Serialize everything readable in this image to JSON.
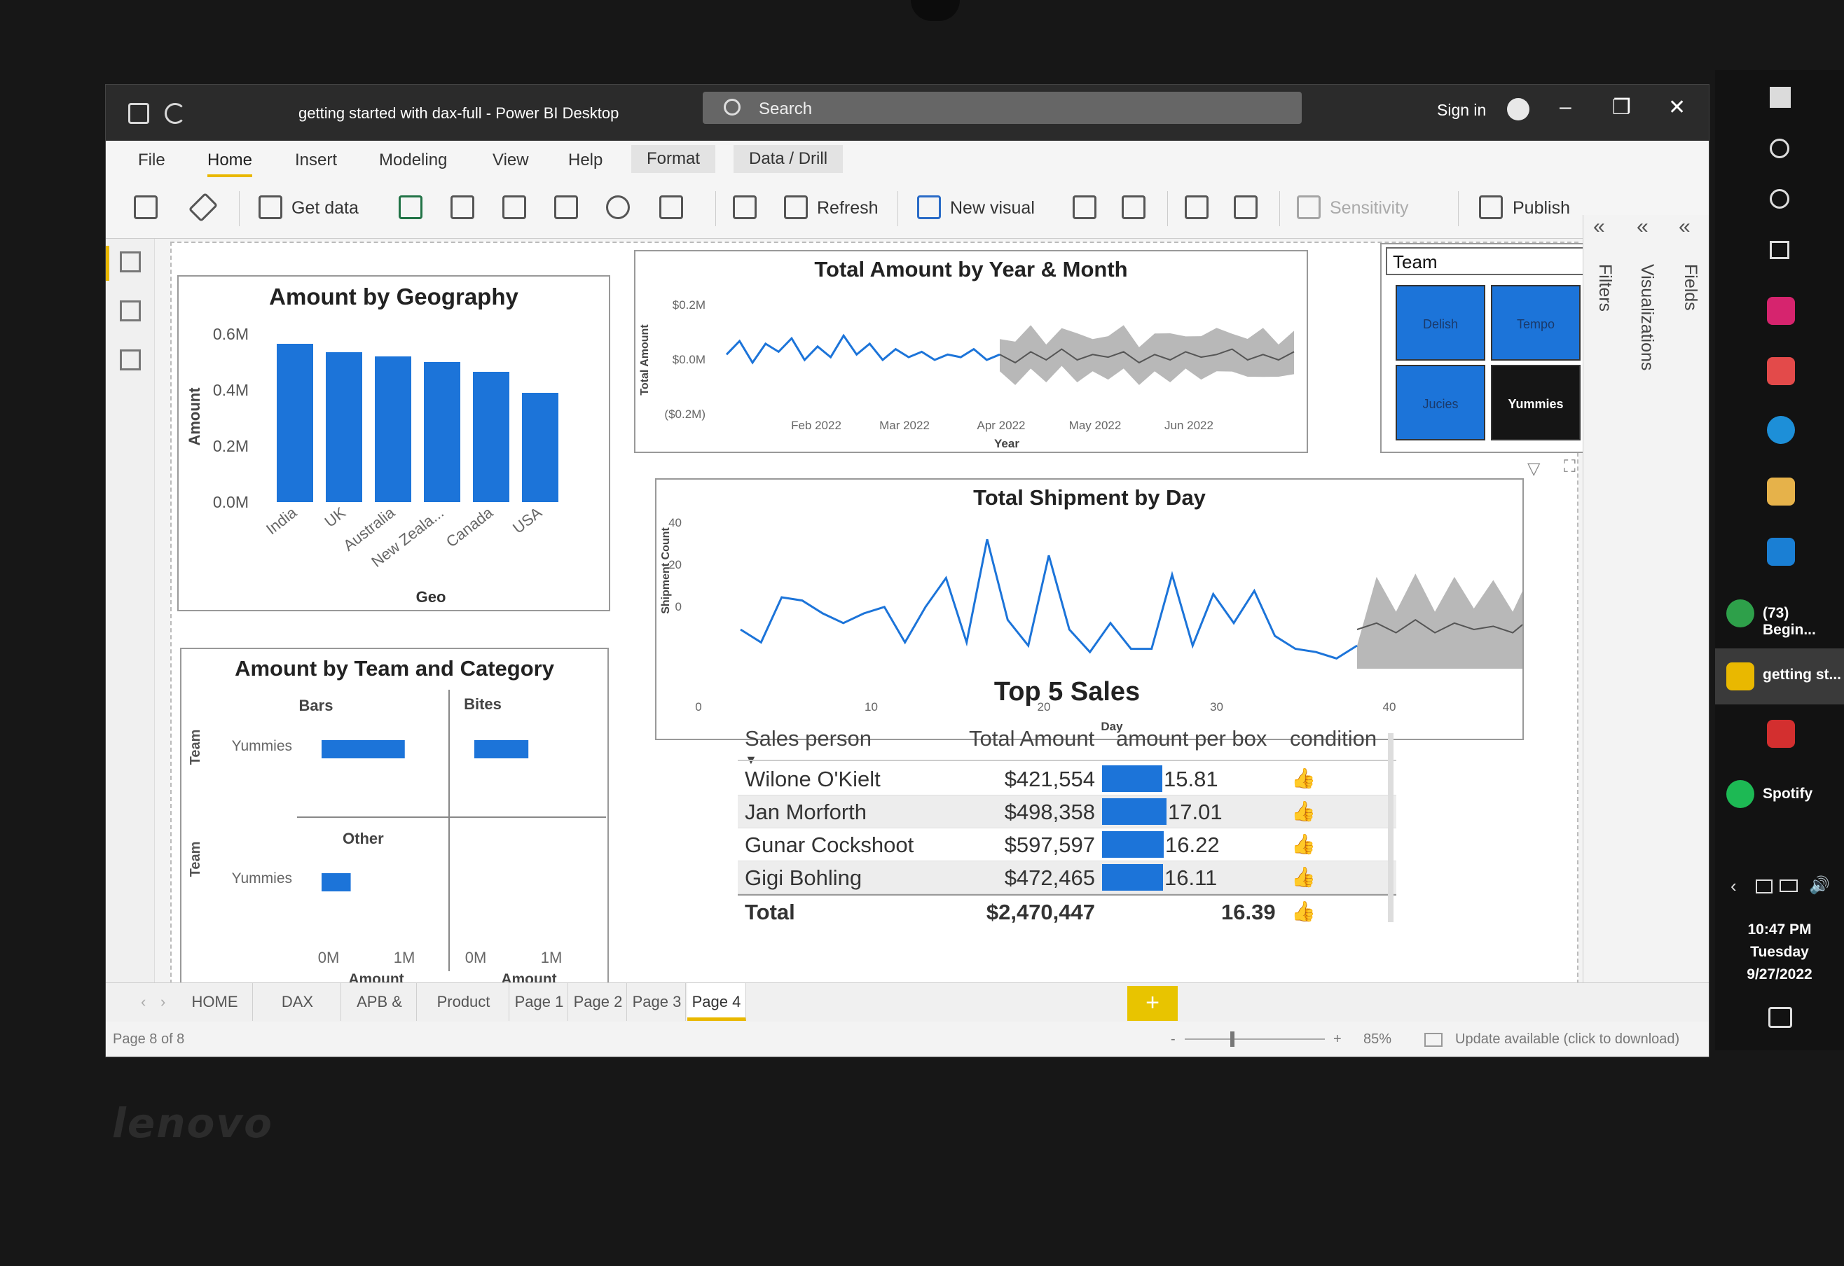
{
  "window": {
    "title": "getting started with dax-full - Power BI Desktop",
    "search_placeholder": "Search",
    "sign_in": "Sign in"
  },
  "menu": [
    "File",
    "Home",
    "Insert",
    "Modeling",
    "View",
    "Help",
    "Format",
    "Data / Drill"
  ],
  "ribbon": {
    "get_data": "Get data",
    "refresh": "Refresh",
    "new_visual": "New visual",
    "sensitivity": "Sensitivity",
    "publish": "Publish"
  },
  "panes": {
    "filters": "Filters",
    "visualizations": "Visualizations",
    "fields": "Fields"
  },
  "visuals": {
    "geo": {
      "title": "Amount by Geography",
      "xlabel": "Geo",
      "ylabel": "Amount",
      "yticks": [
        "0.6M",
        "0.4M",
        "0.2M",
        "0.0M"
      ]
    },
    "team_cat": {
      "title": "Amount by Team and Category",
      "col1": "Bars",
      "col2": "Bites",
      "row2_group": "Other",
      "team_label": "Team",
      "member": "Yummies",
      "xticks": [
        "0M",
        "1M",
        "0M",
        "1M"
      ],
      "xlabel": "Amount"
    },
    "year_month": {
      "title": "Total Amount by Year & Month",
      "ylabel": "Total Amount",
      "xlabel": "Year",
      "yticks": [
        "$0.2M",
        "$0.0M",
        "($0.2M)"
      ],
      "xticks": [
        "Feb 2022",
        "Mar 2022",
        "Apr 2022",
        "May 2022",
        "Jun 2022"
      ]
    },
    "shipment": {
      "title": "Total Shipment by Day",
      "ylabel": "Shipment Count",
      "xlabel": "Day",
      "yticks": [
        "40",
        "20",
        "0"
      ],
      "xticks": [
        "0",
        "10",
        "20",
        "30",
        "40"
      ]
    },
    "slicer": {
      "field": "Team",
      "tiles": [
        "Delish",
        "Tempo",
        "Jucies",
        "Yummies"
      ]
    },
    "top5": {
      "title": "Top 5 Sales",
      "headers": [
        "Sales person",
        "Total Amount",
        "amount per box",
        "condition"
      ],
      "rows": [
        {
          "name": "Wilone O'Kielt",
          "amount": "$421,554",
          "per_box": "15.81",
          "per_box_value": 15.81
        },
        {
          "name": "Jan Morforth",
          "amount": "$498,358",
          "per_box": "17.01",
          "per_box_value": 17.01
        },
        {
          "name": "Gunar Cockshoot",
          "amount": "$597,597",
          "per_box": "16.22",
          "per_box_value": 16.22
        },
        {
          "name": "Gigi Bohling",
          "amount": "$472,465",
          "per_box": "16.11",
          "per_box_value": 16.11
        }
      ],
      "total": {
        "label": "Total",
        "amount": "$2,470,447",
        "per_box": "16.39"
      }
    }
  },
  "chart_data": [
    {
      "type": "bar",
      "title": "Amount by Geography",
      "categories": [
        "India",
        "UK",
        "Australia",
        "New Zeala...",
        "Canada",
        "USA"
      ],
      "values": [
        0.565,
        0.535,
        0.52,
        0.5,
        0.465,
        0.39
      ],
      "xlabel": "Geo",
      "ylabel": "Amount",
      "ylim": [
        0,
        0.6
      ],
      "units": "M"
    },
    {
      "type": "bar",
      "title": "Amount by Team and Category",
      "series": [
        {
          "name": "Bars",
          "row": "Yummies",
          "values": [
            1.0
          ]
        },
        {
          "name": "Bites",
          "row": "Yummies",
          "values": [
            0.65
          ]
        },
        {
          "name": "Other",
          "row": "Yummies",
          "values": [
            0.35
          ]
        }
      ],
      "xlabel": "Amount",
      "xlim": [
        0,
        1.2
      ]
    },
    {
      "type": "line",
      "title": "Total Amount by Year & Month",
      "x": [
        "Feb 2022",
        "Mar 2022",
        "Apr 2022",
        "May 2022",
        "Jun 2022"
      ],
      "actual": [
        0.02,
        0.07,
        -0.01,
        0.06,
        0.03,
        0.08,
        0.0,
        0.05,
        0.01,
        0.09,
        0.02,
        0.06,
        0.0,
        0.04,
        0.01,
        0.03,
        0.0,
        0.02,
        0.01,
        0.04,
        0.0,
        0.02
      ],
      "forecast": [
        0.02,
        -0.01,
        0.03,
        0.0,
        0.04,
        0.0,
        0.02,
        0.01,
        0.03,
        -0.01,
        0.02,
        0.0,
        0.03,
        0.01,
        0.02,
        0.04,
        0.0,
        0.02,
        0.0,
        0.03
      ],
      "ylim": [
        -0.2,
        0.2
      ],
      "xlabel": "Year",
      "ylabel": "Total Amount"
    },
    {
      "type": "line",
      "title": "Total Shipment by Day",
      "x": [
        1,
        2,
        3,
        4,
        5,
        6,
        7,
        8,
        9,
        10,
        11,
        12,
        13,
        14,
        15,
        16,
        17,
        18,
        19,
        20,
        21,
        22,
        23,
        24,
        25,
        26,
        27,
        28,
        29,
        30,
        31
      ],
      "values": [
        10,
        6,
        20,
        19,
        15,
        12,
        15,
        17,
        6,
        17,
        26,
        6,
        38,
        13,
        5,
        33,
        10,
        3,
        12,
        4,
        4,
        27,
        5,
        21,
        12,
        22,
        8,
        4,
        3,
        1,
        5
      ],
      "forecast_x": [
        31,
        32,
        33,
        34,
        35,
        36,
        37,
        38,
        39,
        40
      ],
      "forecast": [
        10,
        12,
        9,
        13,
        9,
        12,
        10,
        11,
        9,
        14
      ],
      "xlim": [
        0,
        40
      ],
      "ylim": [
        0,
        40
      ],
      "xlabel": "Day",
      "ylabel": "Shipment Count"
    }
  ],
  "tabs": [
    "HOME",
    "DAX Examples",
    "APB & APS",
    "Product Counts",
    "Page 1",
    "Page 2",
    "Page 3",
    "Page 4"
  ],
  "active_tab": "Page 4",
  "status": {
    "page": "Page 8 of 8",
    "zoom": "85%",
    "update": "Update available (click to download)"
  },
  "taskbar": {
    "items": [
      "(73) Begin...",
      "getting st...",
      "Spotify"
    ],
    "time": "10:47 PM",
    "day": "Tuesday",
    "date": "9/27/2022"
  },
  "colors": {
    "accent": "#1c74d9",
    "yellow": "#e9b800",
    "forecast_band": "#b8b8b8"
  }
}
